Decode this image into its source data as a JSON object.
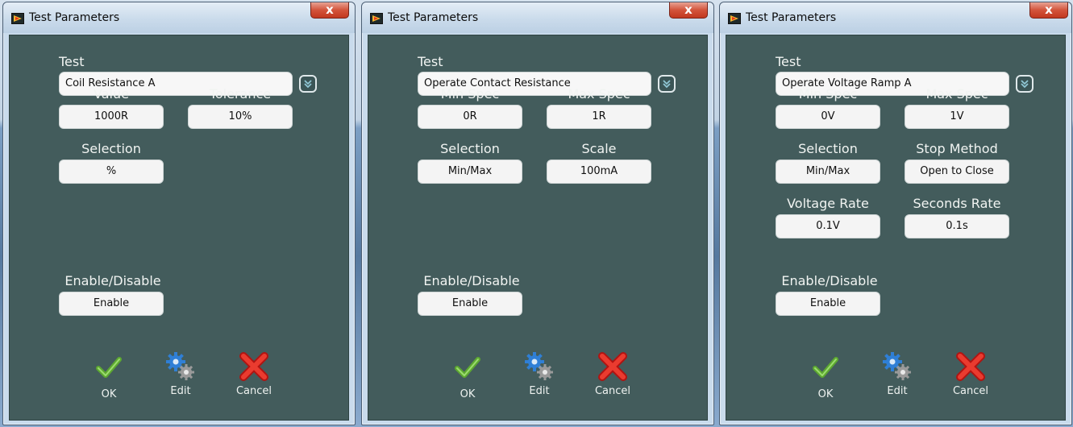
{
  "windows": [
    {
      "title": "Test Parameters",
      "close_label": "x",
      "test_label": "Test",
      "test_value": "Coil Resistance A",
      "fields": [
        {
          "label": "Value",
          "value": "1000R"
        },
        {
          "label": "Tolerance",
          "value": "10%"
        },
        {
          "label": "Selection",
          "value": "%"
        }
      ],
      "enable_label": "Enable/Disable",
      "enable_value": "Enable",
      "ok_label": "OK",
      "edit_label": "Edit",
      "cancel_label": "Cancel"
    },
    {
      "title": "Test Parameters",
      "close_label": "x",
      "test_label": "Test",
      "test_value": "Operate Contact Resistance",
      "fields": [
        {
          "label": "Min Spec",
          "value": "0R"
        },
        {
          "label": "Max Spec",
          "value": "1R"
        },
        {
          "label": "Selection",
          "value": "Min/Max"
        },
        {
          "label": "Scale",
          "value": "100mA"
        }
      ],
      "enable_label": "Enable/Disable",
      "enable_value": "Enable",
      "ok_label": "OK",
      "edit_label": "Edit",
      "cancel_label": "Cancel"
    },
    {
      "title": "Test Parameters",
      "close_label": "x",
      "test_label": "Test",
      "test_value": "Operate Voltage Ramp A",
      "fields": [
        {
          "label": "Min Spec",
          "value": "0V"
        },
        {
          "label": "Max Spec",
          "value": "1V"
        },
        {
          "label": "Selection",
          "value": "Min/Max"
        },
        {
          "label": "Stop Method",
          "value": "Open to Close"
        },
        {
          "label": "Voltage Rate",
          "value": "0.1V"
        },
        {
          "label": "Seconds Rate",
          "value": "0.1s"
        }
      ],
      "enable_label": "Enable/Disable",
      "enable_value": "Enable",
      "ok_label": "OK",
      "edit_label": "Edit",
      "cancel_label": "Cancel"
    }
  ],
  "icons": {
    "app": "labview-run-icon",
    "dropdown": "double-chevron-down-icon",
    "ok": "green-checkmark-icon",
    "edit": "gears-icon",
    "cancel": "red-x-icon"
  },
  "colors": {
    "panel": "#435c5c",
    "field": "#f4f4f4",
    "close": "#c94a32",
    "frame": "#c9dbec"
  }
}
